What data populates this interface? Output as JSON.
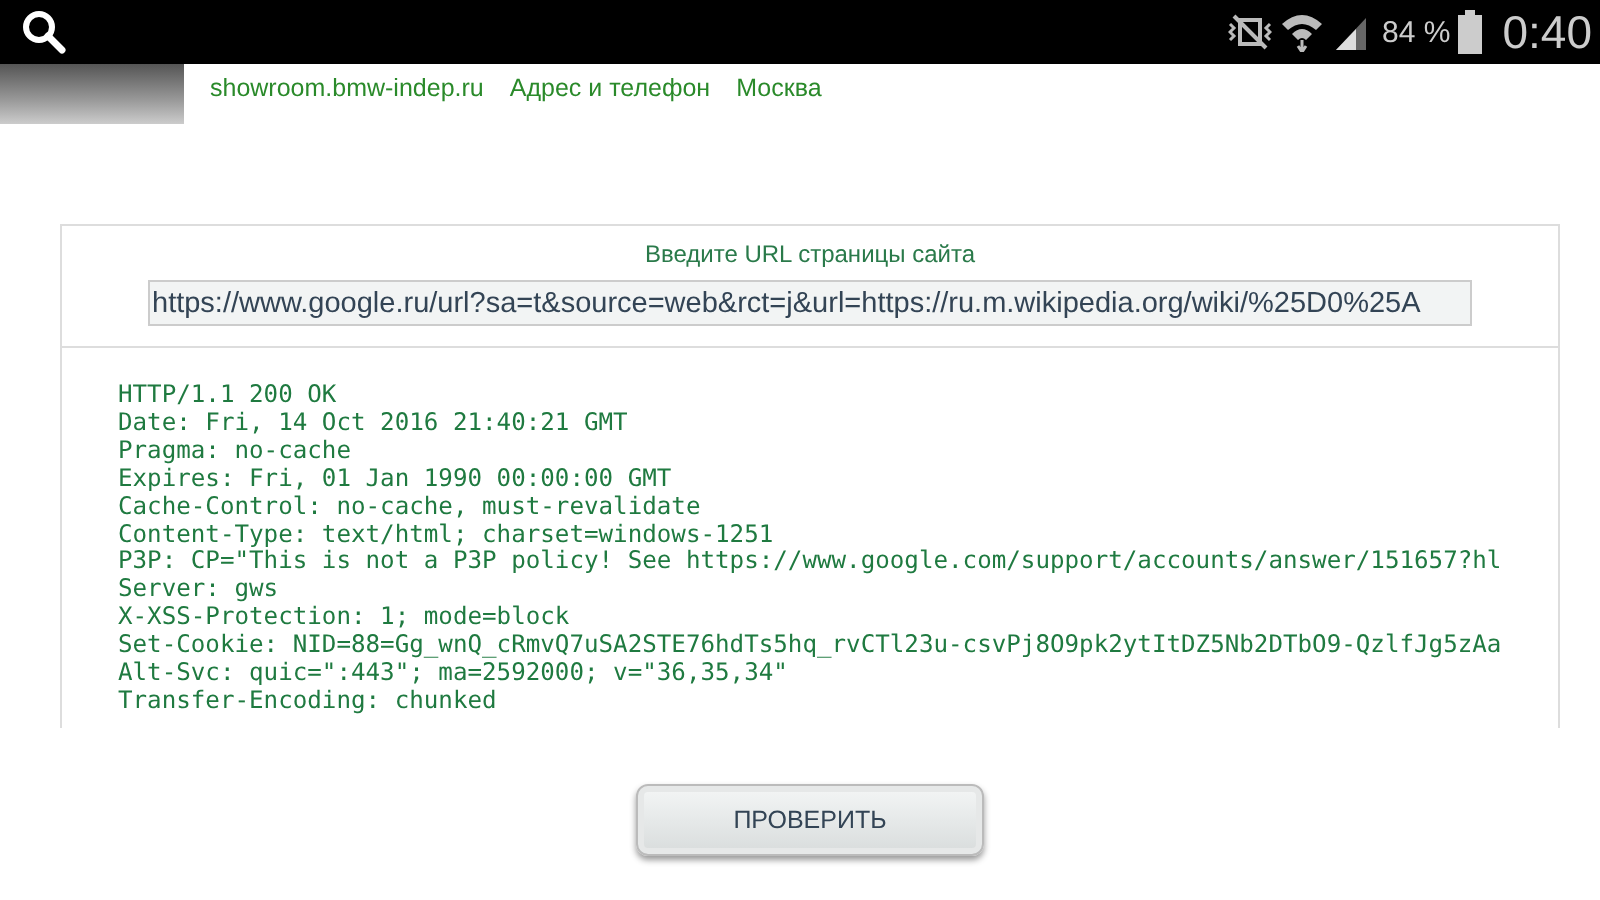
{
  "status_bar": {
    "battery_percent": "84 %",
    "time": "0:40"
  },
  "result_links": [
    "showroom.bmw-indep.ru",
    "Адрес и телефон",
    "Москва"
  ],
  "url_form": {
    "label": "Введите URL страницы сайта",
    "value": "https://www.google.ru/url?sa=t&source=web&rct=j&url=https://ru.m.wikipedia.org/wiki/%25D0%25A"
  },
  "response_headers": [
    "HTTP/1.1 200 OK",
    "Date: Fri, 14 Oct 2016 21:40:21 GMT",
    "Pragma: no-cache",
    "Expires: Fri, 01 Jan 1990 00:00:00 GMT",
    "Cache-Control: no-cache, must-revalidate",
    "Content-Type: text/html; charset=windows-1251",
    "P3P: CP=\"This is not a P3P policy! See https://www.google.com/support/accounts/answer/151657?hl",
    "Server: gws",
    "X-XSS-Protection: 1; mode=block",
    "Set-Cookie: NID=88=Gg_wnQ_cRmvQ7uSA2STE76hdTs5hq_rvCTl23u-csvPj8O9pk2ytItDZ5Nb2DTbO9-QzlfJg5zAa",
    "Alt-Svc: quic=\":443\"; ma=2592000; v=\"36,35,34\"",
    "Transfer-Encoding: chunked"
  ],
  "check_button": "ПРОВЕРИТЬ"
}
